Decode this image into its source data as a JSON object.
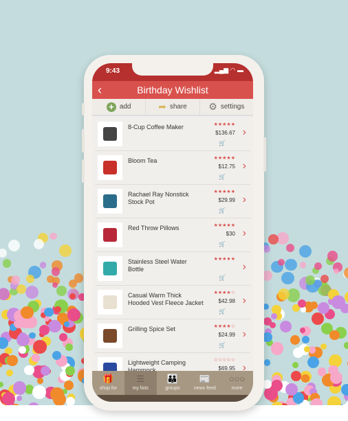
{
  "status": {
    "time": "9:43",
    "icons": "▂▄▆ ◠ ▬"
  },
  "header": {
    "title": "Birthday Wishlist",
    "back_icon": "chevron-left-icon"
  },
  "toolbar": {
    "add": "add",
    "share": "share",
    "settings": "settings"
  },
  "items": [
    {
      "name": "8-Cup Coffee Maker",
      "stars": "★★★★★",
      "rating": 5,
      "price": "$136.67"
    },
    {
      "name": "Bloom Tea",
      "stars": "★★★★★",
      "rating": 5,
      "price": "$12.75"
    },
    {
      "name": "Rachael Ray Nonstick Stock Pot",
      "stars": "★★★★★",
      "rating": 5,
      "price": "$29.99"
    },
    {
      "name": "Red Throw Pillows",
      "stars": "★★★★★",
      "rating": 5,
      "price": "$30"
    },
    {
      "name": "Stainless Steel Water Bottle",
      "stars": "★★★★★",
      "rating": 5,
      "price": ""
    },
    {
      "name": "Casual Warm Thick Hooded Vest Fleece Jacket",
      "stars": "★★★★☆",
      "rating": 4,
      "price": "$42.98"
    },
    {
      "name": "Grilling Spice Set",
      "stars": "★★★★☆",
      "rating": 4,
      "price": "$24.99"
    },
    {
      "name": "Lightweight Camping Hammock",
      "stars": "☆☆☆☆☆",
      "rating": 0,
      "price": "$69.95"
    }
  ],
  "tabs": [
    {
      "label": "shop for",
      "icon": "gift-icon"
    },
    {
      "label": "my lists",
      "icon": "list-icon",
      "active": true
    },
    {
      "label": "groups",
      "icon": "people-icon"
    },
    {
      "label": "news feed",
      "icon": "newspaper-icon"
    },
    {
      "label": "more",
      "icon": "more-icon"
    }
  ],
  "colors": {
    "accent": "#d9514d",
    "tabbar": "#a79884",
    "background": "#c4dcdd"
  }
}
